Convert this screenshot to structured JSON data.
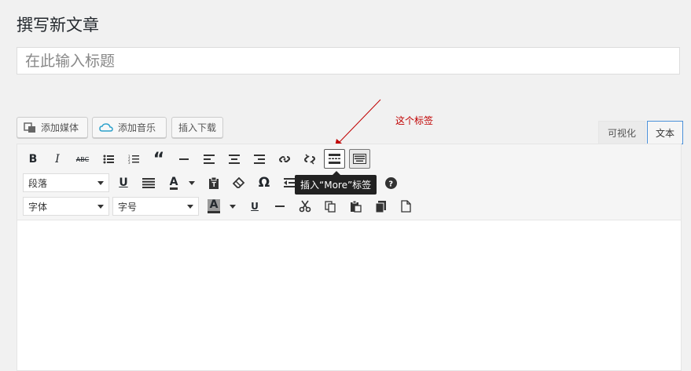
{
  "page": {
    "title": "撰写新文章"
  },
  "post_title": {
    "placeholder": "在此输入标题"
  },
  "media_buttons": [
    {
      "label": "添加媒体"
    },
    {
      "label": "添加音乐"
    },
    {
      "label": "插入下载"
    }
  ],
  "annotation": {
    "text": "这个标签",
    "color": "#c00000"
  },
  "editor_tabs": {
    "visual": "可视化",
    "text": "文本"
  },
  "toolbar": {
    "format_select": "段落",
    "font_family_select": "字体",
    "font_size_select": "字号",
    "tooltip": "插入“More”标签"
  },
  "colors": {
    "accent": "#4a90d9",
    "tooltip_bg": "#222222"
  }
}
